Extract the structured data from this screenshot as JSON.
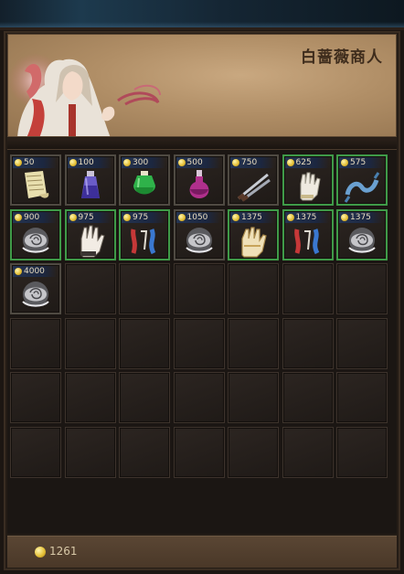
{
  "merchant": {
    "name": "白蔷薇商人"
  },
  "shop": {
    "items": [
      {
        "price": "50",
        "icon": "scroll-icon",
        "rarity": "common"
      },
      {
        "price": "100",
        "icon": "blue-potion-icon",
        "rarity": "common"
      },
      {
        "price": "300",
        "icon": "green-potion-icon",
        "rarity": "common"
      },
      {
        "price": "500",
        "icon": "purple-potion-icon",
        "rarity": "common"
      },
      {
        "price": "750",
        "icon": "twin-blades-icon",
        "rarity": "common"
      },
      {
        "price": "625",
        "icon": "white-glove-icon",
        "rarity": "rare"
      },
      {
        "price": "575",
        "icon": "blue-sash-icon",
        "rarity": "rare"
      },
      {
        "price": "900",
        "icon": "silver-rose-icon",
        "rarity": "rare"
      },
      {
        "price": "975",
        "icon": "dark-glove-icon",
        "rarity": "rare"
      },
      {
        "price": "975",
        "icon": "ribbon-pair-icon",
        "rarity": "rare"
      },
      {
        "price": "1050",
        "icon": "silver-rose-icon",
        "rarity": "common"
      },
      {
        "price": "1375",
        "icon": "gold-gauntlet-icon",
        "rarity": "rare"
      },
      {
        "price": "1375",
        "icon": "ribbon-pair-icon",
        "rarity": "rare"
      },
      {
        "price": "1375",
        "icon": "silver-rose-icon",
        "rarity": "rare"
      },
      {
        "price": "4000",
        "icon": "silver-rose-icon",
        "rarity": "common"
      }
    ]
  },
  "player": {
    "gold": "1261"
  }
}
